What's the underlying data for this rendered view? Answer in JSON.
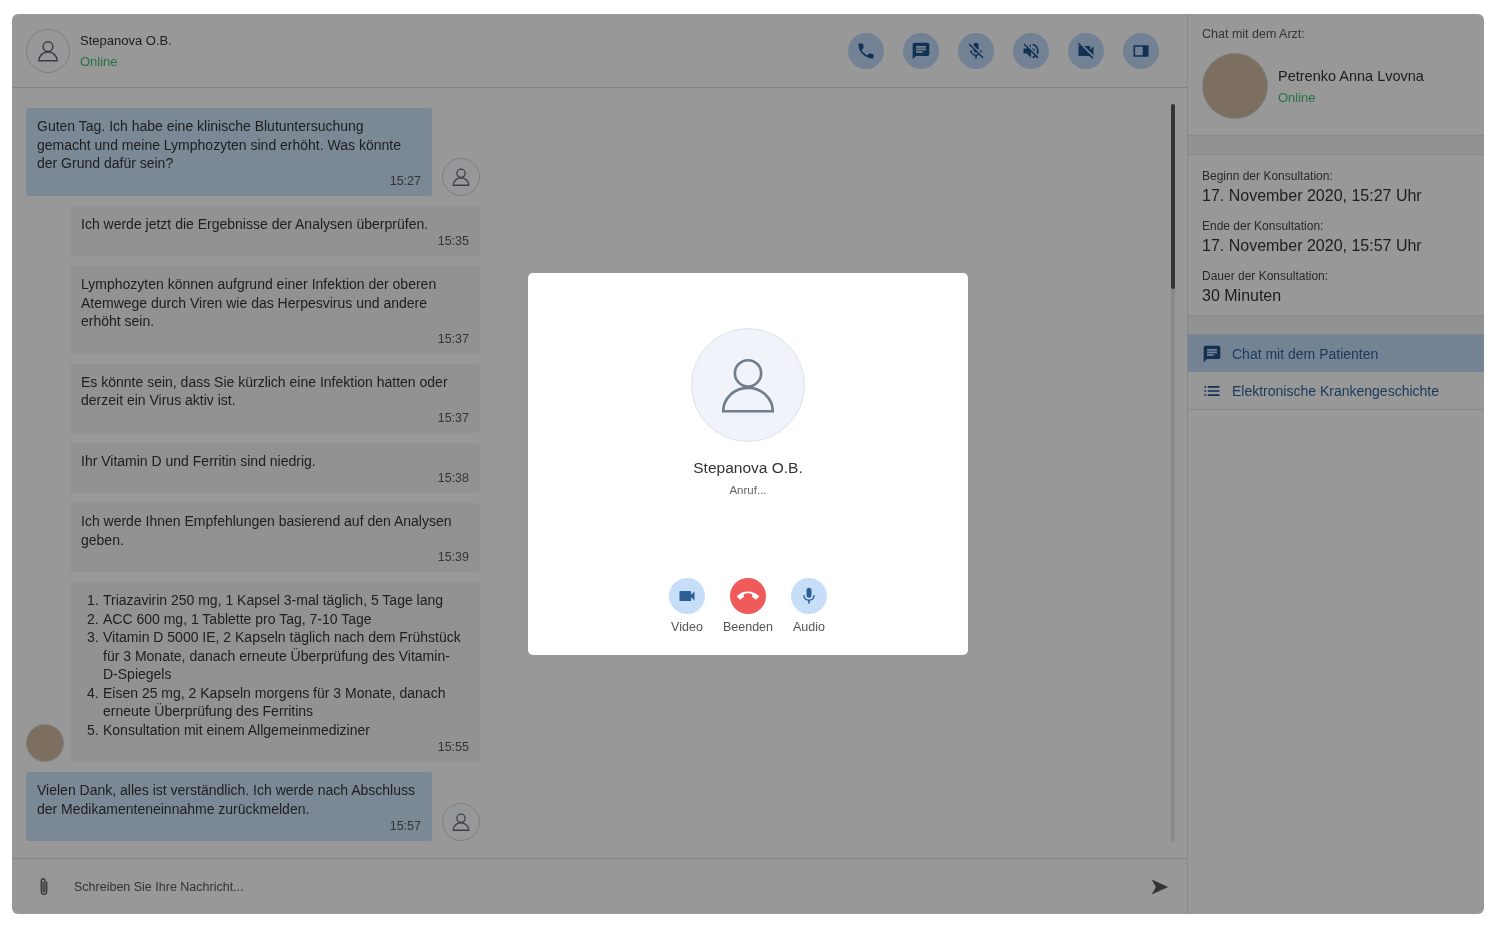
{
  "chat_header": {
    "name": "Stepanova O.B.",
    "status": "Online"
  },
  "messages": [
    {
      "kind": "patient",
      "text": "Guten Tag. Ich habe eine klinische Blutuntersuchung gemacht und meine Lymphozyten sind erhöht. Was könnte der Grund dafür sein?",
      "time": "15:27"
    },
    {
      "kind": "doctor",
      "text": "Ich werde jetzt die Ergebnisse der Analysen überprüfen.",
      "time": "15:35"
    },
    {
      "kind": "doctor",
      "text": "Lymphozyten können aufgrund einer Infektion der oberen Atemwege durch Viren wie das Herpesvirus und andere erhöht sein.",
      "time": "15:37"
    },
    {
      "kind": "doctor",
      "text": "Es könnte sein, dass Sie kürzlich eine Infektion hatten oder derzeit ein Virus aktiv ist.",
      "time": "15:37"
    },
    {
      "kind": "doctor",
      "text": "Ihr Vitamin D und Ferritin sind niedrig.",
      "time": "15:38"
    },
    {
      "kind": "doctor",
      "text": "Ich werde Ihnen Empfehlungen basierend auf den Analysen geben.",
      "time": "15:39"
    },
    {
      "kind": "doctor",
      "items": [
        {
          "marker": "1.",
          "text": "Triazavirin 250 mg, 1 Kapsel 3-mal täglich, 5 Tage lang"
        },
        {
          "marker": "2.",
          "text": "ACC 600 mg, 1 Tablette pro Tag, 7-10 Tage"
        },
        {
          "marker": "3.",
          "text": "Vitamin D 5000 IE, 2 Kapseln täglich nach dem Frühstück für 3 Monate, danach erneute Überprüfung des Vitamin-D-Spiegels"
        },
        {
          "marker": "4.",
          "text": "Eisen 25 mg, 2 Kapseln morgens für 3 Monate, danach erneute Überprüfung des Ferritins"
        },
        {
          "marker": "5.",
          "text": "Konsultation mit einem Allgemeinmediziner"
        }
      ],
      "time": "15:55"
    },
    {
      "kind": "patient",
      "text": "Vielen Dank, alles ist verständlich. Ich werde nach Abschluss der Medikamenteneinnahme zurückmelden.",
      "time": "15:57"
    }
  ],
  "composer": {
    "placeholder": "Schreiben Sie Ihre Nachricht..."
  },
  "sidebar": {
    "title": "Chat mit dem Arzt:",
    "doctor_name": "Petrenko Anna Lvovna",
    "doctor_status": "Online",
    "details": [
      {
        "label": "Beginn der Konsultation:",
        "value": "17. November 2020, 15:27 Uhr"
      },
      {
        "label": "Ende der Konsultation:",
        "value": "17. November 2020, 15:57 Uhr"
      },
      {
        "label": "Dauer der Konsultation:",
        "value": "30 Minuten"
      }
    ],
    "nav": [
      {
        "kind": "chat",
        "label": "Chat mit dem Patienten",
        "selected": true
      },
      {
        "kind": "list",
        "label": "Elektronische Krankengeschichte",
        "selected": false
      }
    ]
  },
  "call_dialog": {
    "name": "Stepanova O.B.",
    "status": "Anruf...",
    "actions": [
      {
        "kind": "video",
        "label": "Video"
      },
      {
        "kind": "end",
        "label": "Beenden"
      },
      {
        "kind": "audio",
        "label": "Audio"
      }
    ]
  }
}
